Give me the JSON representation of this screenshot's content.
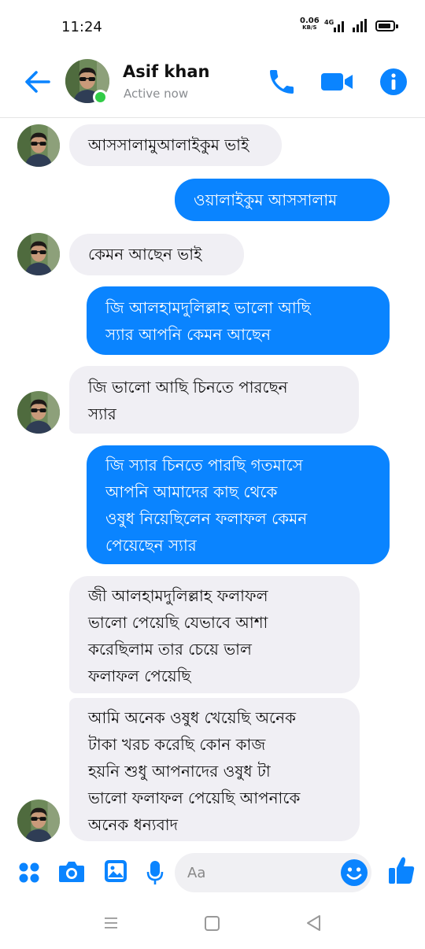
{
  "status_bar": {
    "time": "11:24",
    "net_speed": "0.06",
    "net_unit": "KB/S",
    "network": "4G"
  },
  "header": {
    "contact_name": "Asif khan",
    "status": "Active now",
    "back_icon": "arrow-left-icon",
    "call_icon": "phone-icon",
    "video_icon": "video-camera-icon",
    "info_icon": "info-icon"
  },
  "colors": {
    "accent": "#0a84ff",
    "incoming_bubble": "#f0eff4",
    "online": "#31cc46"
  },
  "messages": [
    {
      "direction": "in",
      "lines": [
        "আসসালামুআলাইকুম ভাই"
      ]
    },
    {
      "direction": "out",
      "lines": [
        "ওয়ালাইকুম আসসালাম"
      ]
    },
    {
      "direction": "in",
      "lines": [
        "কেমন আছেন ভাই"
      ]
    },
    {
      "direction": "out",
      "lines": [
        "জি আলহামদুলিল্লাহ ভালো আছি",
        "স্যার আপনি কেমন আছেন"
      ]
    },
    {
      "direction": "in",
      "lines": [
        "জি ভালো আছি চিনতে পারছেন",
        "স্যার"
      ]
    },
    {
      "direction": "out",
      "lines": [
        "জি স্যার চিনতে পারছি গতমাসে",
        "আপনি আমাদের কাছ থেকে",
        "ওষুধ নিয়েছিলেন ফলাফল কেমন",
        "পেয়েছেন স্যার"
      ]
    },
    {
      "direction": "in",
      "lines": [
        "জী আলহামদুলিল্লাহ ফলাফল",
        "ভালো পেয়েছি যেভাবে আশা",
        "করেছিলাম তার চেয়ে ভাল",
        "ফলাফল পেয়েছি"
      ]
    },
    {
      "direction": "in",
      "lines": [
        "আমি অনেক ওষুধ খেয়েছি অনেক",
        "টাকা খরচ করেছি  কোন কাজ",
        "হয়নি শুধু আপনাদের ওষুধ টা",
        "ভালো ফলাফল পেয়েছি আপনাকে",
        "অনেক ধন্যবাদ"
      ]
    }
  ],
  "composer": {
    "placeholder": "Aa",
    "icons": [
      "apps-icon",
      "camera-icon",
      "gallery-icon",
      "microphone-icon",
      "emoji-icon",
      "thumbs-up-icon"
    ]
  },
  "nav_bar": {
    "icons": [
      "menu-icon",
      "home-icon",
      "back-triangle-icon"
    ]
  }
}
